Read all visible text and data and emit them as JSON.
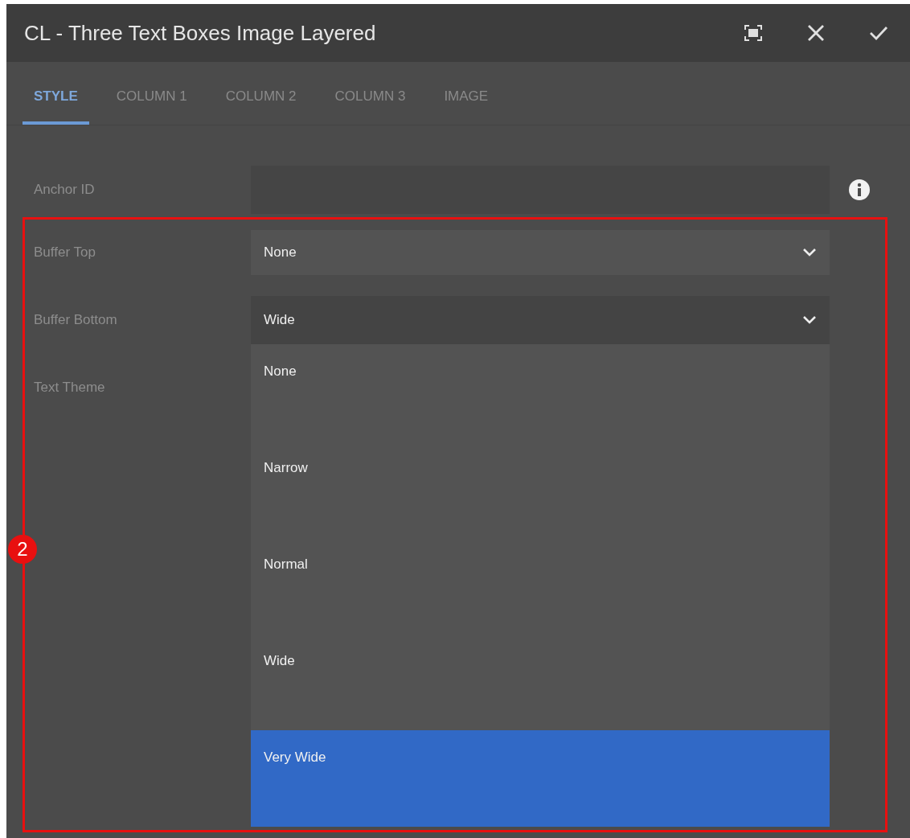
{
  "dialog": {
    "title": "CL - Three Text Boxes Image Layered"
  },
  "tabs": [
    {
      "label": "STYLE",
      "selected": true
    },
    {
      "label": "COLUMN 1",
      "selected": false
    },
    {
      "label": "COLUMN 2",
      "selected": false
    },
    {
      "label": "COLUMN 3",
      "selected": false
    },
    {
      "label": "IMAGE",
      "selected": false
    }
  ],
  "fields": [
    {
      "kind": "text",
      "label": "Anchor ID",
      "info": true
    },
    {
      "kind": "select",
      "label": "Buffer Top",
      "value": "None",
      "expanded": false
    },
    {
      "kind": "select",
      "label": "Buffer Bottom",
      "value": "Wide",
      "expanded": true,
      "options": [
        {
          "label": "None",
          "highlighted": false
        },
        {
          "label": "Narrow",
          "highlighted": false
        },
        {
          "label": "Normal",
          "highlighted": false
        },
        {
          "label": "Wide",
          "highlighted": false
        },
        {
          "label": "Very Wide",
          "highlighted": true
        }
      ]
    },
    {
      "kind": "label",
      "label": "Text Theme"
    }
  ],
  "annotation": {
    "badge": "2"
  }
}
